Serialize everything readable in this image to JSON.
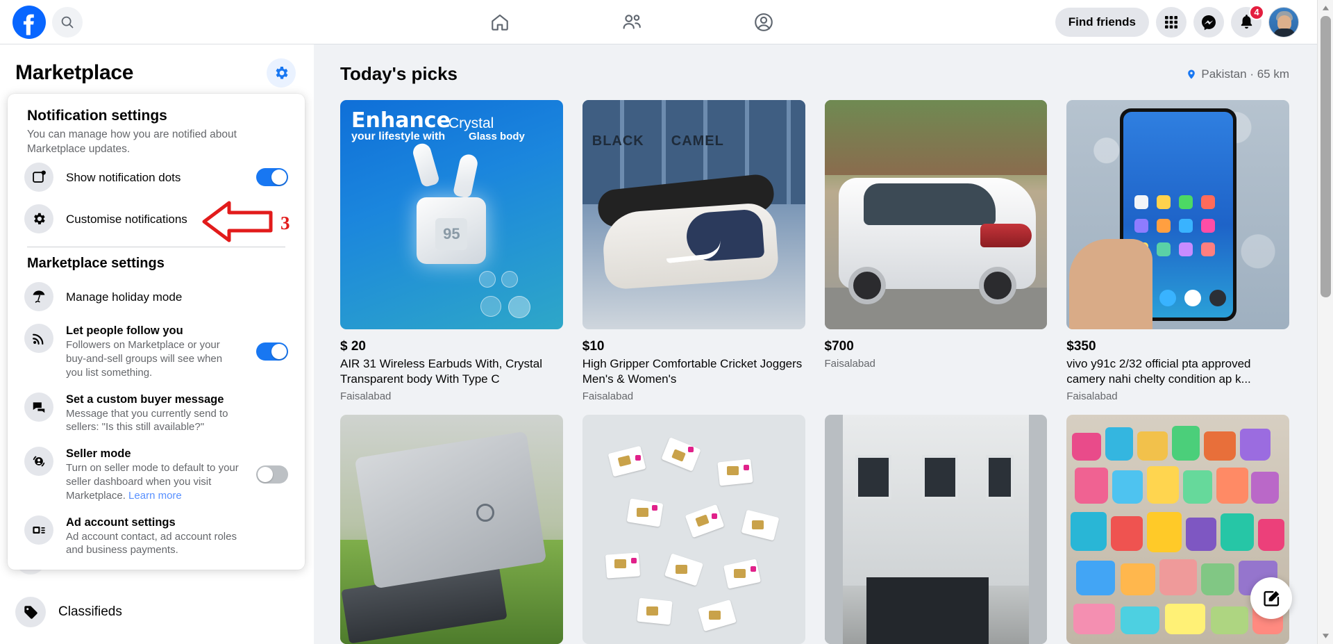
{
  "topbar": {
    "logo_icon": "facebook-logo",
    "search_icon": "search-icon",
    "nav": [
      {
        "icon": "home-icon",
        "name": "home"
      },
      {
        "icon": "friends-icon",
        "name": "friends"
      },
      {
        "icon": "profile-circle-icon",
        "name": "profile"
      }
    ],
    "find_friends_label": "Find friends",
    "menu_icon": "grid-menu-icon",
    "messenger_icon": "messenger-icon",
    "notifications_icon": "bell-icon",
    "notifications_count": "4",
    "account_icon": "avatar"
  },
  "sidebar": {
    "title": "Marketplace",
    "settings_icon": "gear-icon",
    "accent_color": "#1877f2",
    "bottom_item": {
      "label": "Classifieds",
      "icon": "price-tag-icon"
    }
  },
  "settings_panel": {
    "notification": {
      "heading": "Notification settings",
      "description": "You can manage how you are notified about Marketplace updates.",
      "rows": [
        {
          "label": "Show notification dots",
          "icon": "notification-dot-icon",
          "toggle": "on"
        },
        {
          "label": "Customise notifications",
          "icon": "gear-icon",
          "toggle": "none"
        }
      ]
    },
    "marketplace": {
      "heading": "Marketplace settings",
      "rows": [
        {
          "label": "Manage holiday mode",
          "icon": "beach-umbrella-icon",
          "description": "",
          "toggle": "none",
          "bold": false
        },
        {
          "label": "Let people follow you",
          "icon": "rss-icon",
          "description": "Followers on Marketplace or your buy-and-sell groups will see when you list something.",
          "toggle": "on",
          "bold": true
        },
        {
          "label": "Set a custom buyer message",
          "icon": "chat-bubbles-icon",
          "description": "Message that you currently send to sellers: \"Is this still available?\"",
          "toggle": "none",
          "bold": true
        },
        {
          "label": "Seller mode",
          "icon": "seller-swap-icon",
          "description": "Turn on seller mode to default to your seller dashboard when you visit Marketplace. ",
          "link": "Learn more",
          "toggle": "off",
          "bold": true
        },
        {
          "label": "Ad account settings",
          "icon": "ad-account-icon",
          "description": "Ad account contact, ad account roles and business payments.",
          "toggle": "none",
          "bold": true
        }
      ]
    }
  },
  "annotation": {
    "step_number": "3",
    "color": "#e21b1b",
    "icon": "left-arrow-annotation"
  },
  "main": {
    "title": "Today's picks",
    "location_icon": "location-pin-icon",
    "location": "Pakistan · 65 km",
    "fab_icon": "create-listing-pencil-icon",
    "listings": [
      {
        "price": "$ 20",
        "title": "AIR 31 Wireless Earbuds With, Crystal Transparent body With Type C",
        "location": "Faisalabad",
        "image": "wireless-earbuds-ad",
        "image_text": {
          "line1": "Enhance",
          "line2": "your lifestyle with",
          "line3": "Crystal",
          "line4": "Glass body",
          "display": "95"
        }
      },
      {
        "price": "$10",
        "title": "High Gripper Comfortable Cricket Joggers Men's & Women's",
        "location": "Faisalabad",
        "image": "cricket-joggers-shoe",
        "image_text": {
          "word_left": "BLACK",
          "word_right": "CAMEL"
        }
      },
      {
        "price": "$700",
        "title": "",
        "location": "Faisalabad",
        "image": "white-sedan-car"
      },
      {
        "price": "$350",
        "title": "vivo y91c 2/32 official pta approved camery nahi chelty condition ap k...",
        "location": "Faisalabad",
        "image": "vivo-phone-in-hand"
      },
      {
        "price": "",
        "title": "",
        "location": "",
        "image": "dell-laptop-on-grass"
      },
      {
        "price": "",
        "title": "",
        "location": "",
        "image": "sim-cards-pile"
      },
      {
        "price": "",
        "title": "",
        "location": "",
        "image": "house-exterior"
      },
      {
        "price": "",
        "title": "",
        "location": "",
        "image": "plastic-wares-shop"
      }
    ]
  },
  "scrollbar": {
    "up_icon": "scroll-up-arrow",
    "down_icon": "scroll-down-arrow"
  }
}
